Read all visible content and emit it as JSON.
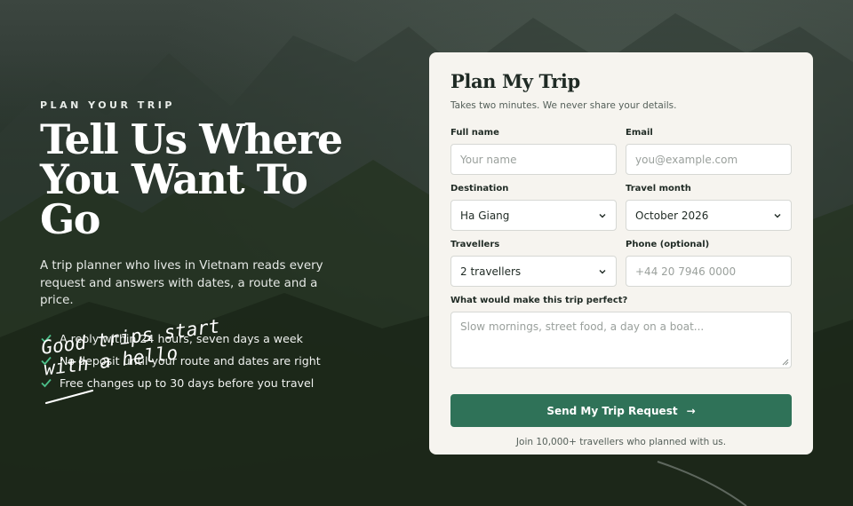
{
  "hero": {
    "eyebrow": "PLAN YOUR TRIP",
    "headline_line1": "Tell Us Where",
    "headline_line2": "You Want To Go",
    "lead": "A trip planner who lives in Vietnam reads every request and answers with dates, a route and a price.",
    "benefits": [
      "A reply within 24 hours, seven days a week",
      "No deposit until your route and dates are right",
      "Free changes up to 30 days before you travel"
    ],
    "script_line1": "Good trips start",
    "script_line2": "with a hello",
    "check_color": "#4cc08a"
  },
  "form": {
    "title": "Plan My Trip",
    "subtitle": "Takes two minutes. We never share your details.",
    "full_name": {
      "label": "Full name",
      "placeholder": "Your name"
    },
    "email": {
      "label": "Email",
      "placeholder": "you@example.com"
    },
    "destination": {
      "label": "Destination",
      "value": "Ha Giang",
      "icon": "chevron-down-icon"
    },
    "travel_month": {
      "label": "Travel month",
      "value": "October 2026",
      "icon": "chevron-down-icon"
    },
    "travellers": {
      "label": "Travellers",
      "value": "2 travellers",
      "icon": "chevron-down-icon"
    },
    "phone": {
      "label": "Phone (optional)",
      "placeholder": "+44 20 7946 0000"
    },
    "perfect": {
      "label": "What would make this trip perfect?",
      "placeholder": "Slow mornings, street food, a day on a boat..."
    },
    "submit_label": "Send My Trip Request",
    "submit_arrow": "→",
    "footnote": "Join 10,000+ travellers who planned with us.",
    "accent_color": "#2f7258"
  }
}
